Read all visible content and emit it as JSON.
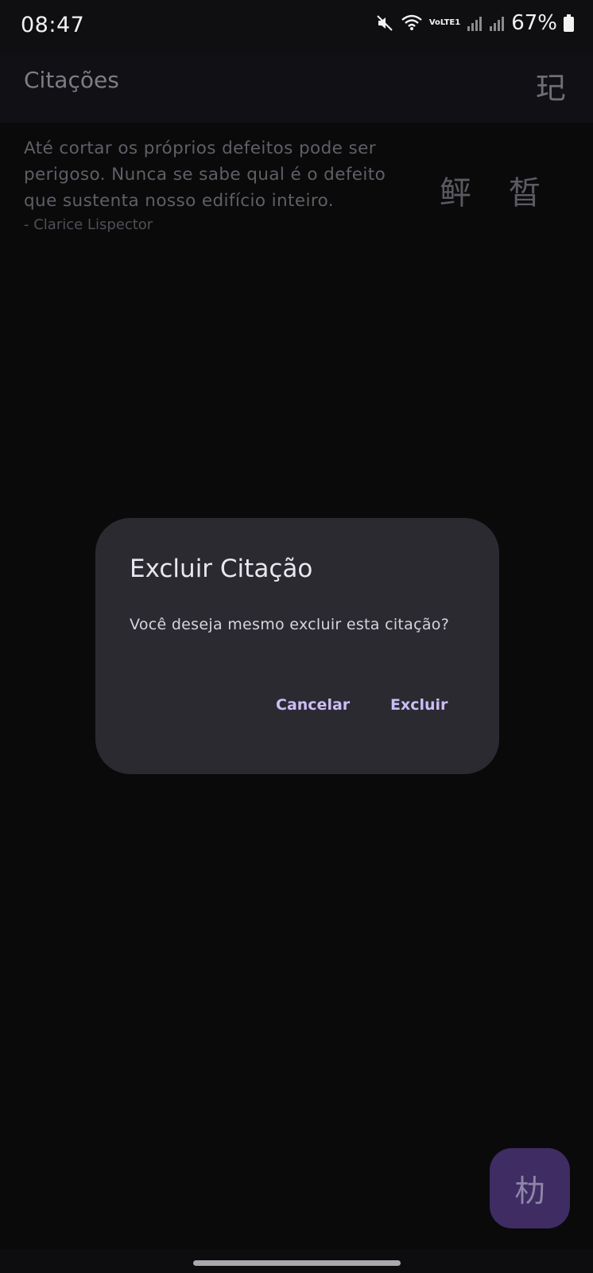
{
  "status_bar": {
    "time": "08:47",
    "network_label": "VoLTE1",
    "battery": "67%",
    "icons": [
      "mute-icon",
      "wifi-icon",
      "volte-icon",
      "signal-icon",
      "signal-icon",
      "battery-icon"
    ]
  },
  "app_bar": {
    "title": "Citações",
    "action_glyph": "玘"
  },
  "quote": {
    "text": "Até cortar os próprios defeitos pode ser perigoso. Nunca se sabe qual é o defeito que sustenta nosso edifício inteiro.",
    "author": "- Clarice Lispector",
    "action_glyphs": [
      "鲆",
      "晳"
    ]
  },
  "dialog": {
    "title": "Excluir Citação",
    "message": "Você deseja mesmo excluir esta citação?",
    "cancel_label": "Cancelar",
    "confirm_label": "Excluir"
  },
  "fab": {
    "glyph": "朸"
  },
  "colors": {
    "background": "#0a0a0b",
    "dialog": "#2b2a31",
    "accent": "#cbbdf4",
    "fab": "#3e2c63"
  }
}
